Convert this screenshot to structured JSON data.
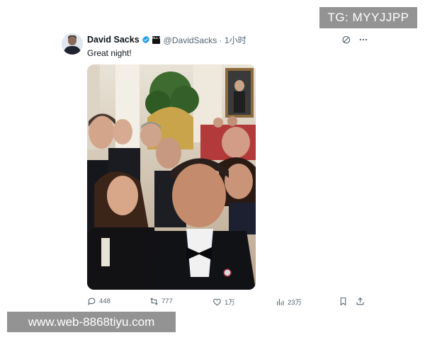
{
  "tweet": {
    "author_name": "David Sacks",
    "author_handle": "@DavidSacks",
    "time": "1小时",
    "affiliate_badge": "ALL IN",
    "text": "Great night!"
  },
  "metrics": {
    "replies": "448",
    "retweets": "777",
    "likes": "1万",
    "views": "23万"
  },
  "watermarks": {
    "top_right": "TG: MYYJJPP",
    "bottom_left": "www.web-8868tiyu.com"
  },
  "colors": {
    "verified": "#1d9bf0",
    "text_primary": "#0f1419",
    "text_secondary": "#536471"
  },
  "icons": [
    "grok-icon",
    "more-icon",
    "reply-icon",
    "retweet-icon",
    "like-icon",
    "views-icon",
    "bookmark-icon",
    "share-icon"
  ]
}
